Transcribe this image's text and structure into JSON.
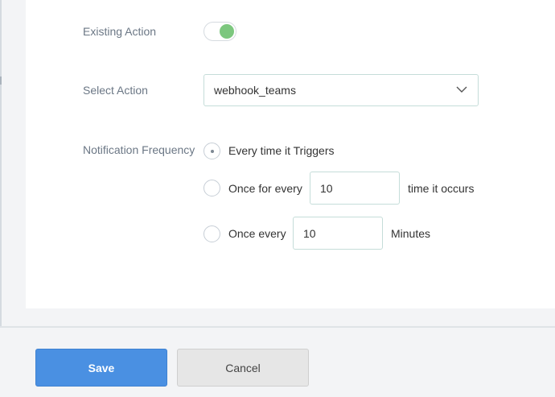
{
  "form": {
    "existing_action": {
      "label": "Existing Action",
      "enabled": true,
      "accent": "#7cc77e"
    },
    "select_action": {
      "label": "Select Action",
      "value": "webhook_teams",
      "icon": "chevron-down-icon"
    },
    "notification_frequency": {
      "label": "Notification Frequency",
      "selected": "every_trigger",
      "options": {
        "every_trigger": {
          "text": "Every time it Triggers"
        },
        "once_for_every": {
          "prefix": "Once for every",
          "value": "10",
          "suffix": "time it occurs"
        },
        "once_every": {
          "prefix": "Once every",
          "value": "10",
          "suffix": "Minutes"
        }
      }
    }
  },
  "footer": {
    "save_label": "Save",
    "cancel_label": "Cancel",
    "save_color": "#4a90e2"
  }
}
